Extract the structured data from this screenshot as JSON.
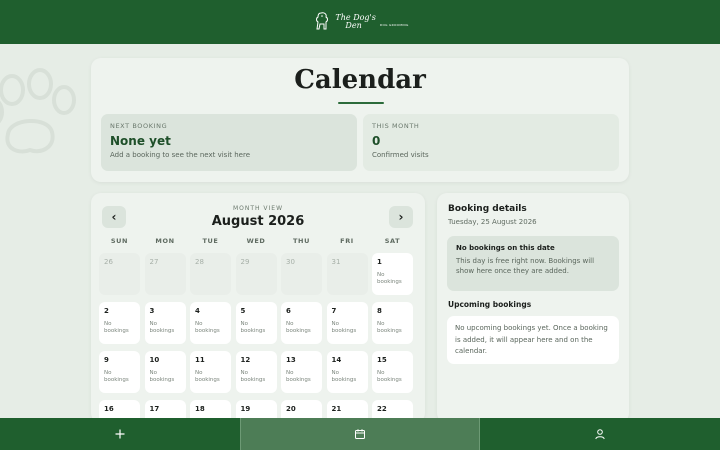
{
  "header": {
    "logo_line1": "The Dog's",
    "logo_line2": "Den",
    "logo_sub": "DOG GROOMING"
  },
  "hero": {
    "title": "Calendar",
    "next_booking": {
      "label": "NEXT BOOKING",
      "value": "None yet",
      "sub": "Add a booking to see the next visit here"
    },
    "this_month": {
      "label": "THIS MONTH",
      "value": "0",
      "sub": "Confirmed visits"
    }
  },
  "calendar": {
    "view_label": "MONTH VIEW",
    "month_title": "August 2026",
    "prev_icon": "chevron-left-icon",
    "next_icon": "chevron-right-icon",
    "weekdays": [
      "SUN",
      "MON",
      "TUE",
      "WED",
      "THU",
      "FRI",
      "SAT"
    ],
    "days": [
      {
        "num": "26",
        "outside": true,
        "note": ""
      },
      {
        "num": "27",
        "outside": true,
        "note": ""
      },
      {
        "num": "28",
        "outside": true,
        "note": ""
      },
      {
        "num": "29",
        "outside": true,
        "note": ""
      },
      {
        "num": "30",
        "outside": true,
        "note": ""
      },
      {
        "num": "31",
        "outside": true,
        "note": ""
      },
      {
        "num": "1",
        "outside": false,
        "note": "No bookings"
      },
      {
        "num": "2",
        "outside": false,
        "note": "No bookings"
      },
      {
        "num": "3",
        "outside": false,
        "note": "No bookings"
      },
      {
        "num": "4",
        "outside": false,
        "note": "No bookings"
      },
      {
        "num": "5",
        "outside": false,
        "note": "No bookings"
      },
      {
        "num": "6",
        "outside": false,
        "note": "No bookings"
      },
      {
        "num": "7",
        "outside": false,
        "note": "No bookings"
      },
      {
        "num": "8",
        "outside": false,
        "note": "No bookings"
      },
      {
        "num": "9",
        "outside": false,
        "note": "No bookings"
      },
      {
        "num": "10",
        "outside": false,
        "note": "No bookings"
      },
      {
        "num": "11",
        "outside": false,
        "note": "No bookings"
      },
      {
        "num": "12",
        "outside": false,
        "note": "No bookings"
      },
      {
        "num": "13",
        "outside": false,
        "note": "No bookings"
      },
      {
        "num": "14",
        "outside": false,
        "note": "No bookings"
      },
      {
        "num": "15",
        "outside": false,
        "note": "No bookings"
      },
      {
        "num": "16",
        "outside": false,
        "note": ""
      },
      {
        "num": "17",
        "outside": false,
        "note": ""
      },
      {
        "num": "18",
        "outside": false,
        "note": ""
      },
      {
        "num": "19",
        "outside": false,
        "note": ""
      },
      {
        "num": "20",
        "outside": false,
        "note": ""
      },
      {
        "num": "21",
        "outside": false,
        "note": ""
      },
      {
        "num": "22",
        "outside": false,
        "note": ""
      }
    ]
  },
  "details": {
    "title": "Booking details",
    "date": "Tuesday, 25 August 2026",
    "no_bookings_title": "No bookings on this date",
    "no_bookings_text": "This day is free right now. Bookings will show here once they are added.",
    "upcoming_title": "Upcoming bookings",
    "upcoming_text": "No upcoming bookings yet. Once a booking is added, it will appear here and on the calendar."
  },
  "bottom_nav": [
    {
      "icon": "plus-icon",
      "active": false
    },
    {
      "icon": "calendar-icon",
      "active": true
    },
    {
      "icon": "user-icon",
      "active": false
    }
  ],
  "colors": {
    "brand_green": "#1f5f2e",
    "active_tab": "#4d7d56",
    "background": "#e6ede6"
  }
}
